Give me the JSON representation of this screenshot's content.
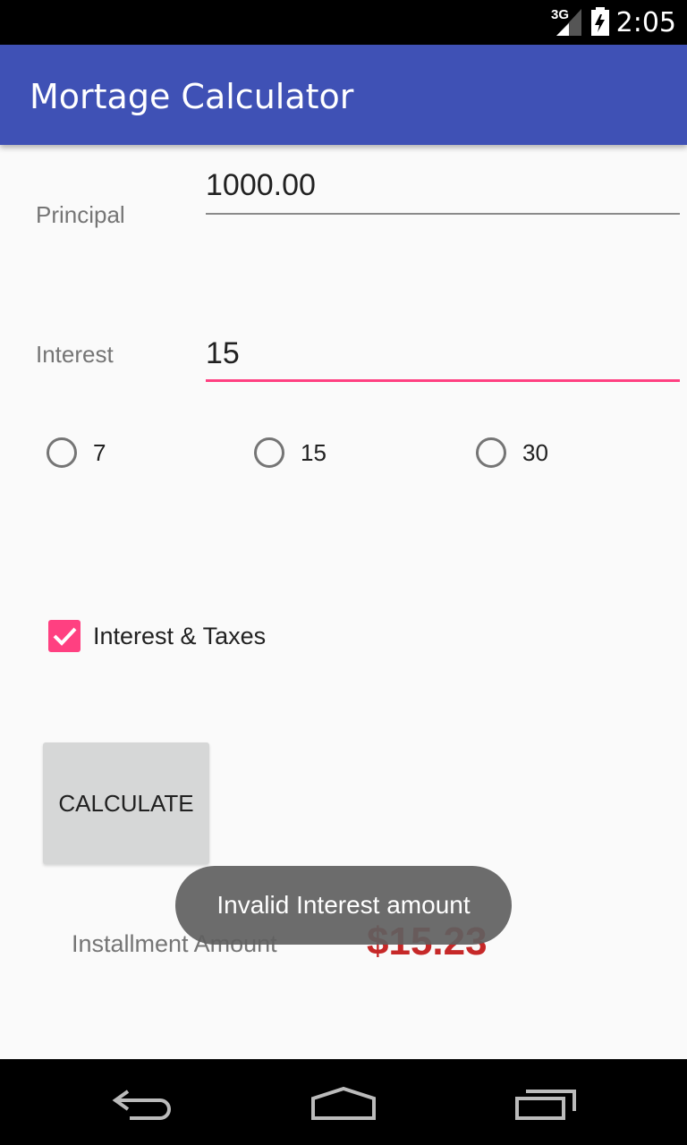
{
  "status_bar": {
    "network": "3G",
    "time": "2:05"
  },
  "app_bar": {
    "title": "Mortage Calculator"
  },
  "form": {
    "principal_label": "Principal",
    "principal_value": "1000.00",
    "interest_label": "Interest",
    "interest_value": "15",
    "term_options": [
      "7",
      "15",
      "30"
    ],
    "taxes_checkbox_label": "Interest & Taxes",
    "taxes_checked": true,
    "calculate_label": "CALCULATE",
    "installment_label": "Installment Amount",
    "installment_value": "$15.23"
  },
  "toast": {
    "message": "Invalid Interest amount"
  },
  "colors": {
    "primary": "#3f51b5",
    "accent": "#ff4081",
    "result": "#c62828"
  },
  "nav_bar": {
    "icons": [
      "back-icon",
      "home-icon",
      "recents-icon"
    ]
  }
}
